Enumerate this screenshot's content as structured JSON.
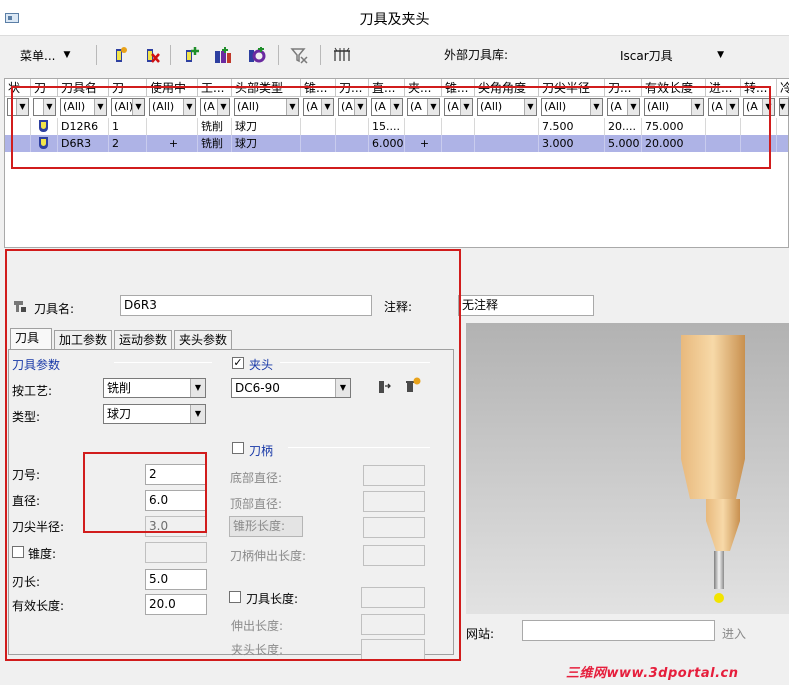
{
  "window": {
    "title": "刀具及夹头"
  },
  "toolbar": {
    "menu_label": "菜单...",
    "external_lib_label": "外部刀具库:",
    "external_lib_value": "Iscar刀具"
  },
  "grid": {
    "headers": [
      "状",
      "刀",
      "刀具名",
      "刀",
      "使用中",
      "工...",
      "头部类型",
      "锥...",
      "刀...",
      "直...",
      "夹...",
      "锥...",
      "尖角角度",
      "刀尖半径",
      "刀...",
      "有效长度",
      "进...",
      "转...",
      "冷"
    ],
    "filters": [
      "",
      "",
      "(All)",
      "(Al)",
      "(All)",
      "(A",
      "(All)",
      "(A",
      "(A",
      "(A",
      "(A",
      "(A",
      "(All)",
      "(All)",
      "(A",
      "(All)",
      "(A",
      "(A",
      "(A"
    ],
    "rows": [
      {
        "name": "D12R6",
        "num": "1",
        "in_use": "",
        "process": "铣削",
        "type": "球刀",
        "diameter": "15....",
        "holder": "",
        "corner_radius": "7.500",
        "col15": "20....",
        "eff_len": "75.000",
        "selected": false
      },
      {
        "name": "D6R3",
        "num": "2",
        "in_use": "+",
        "process": "铣削",
        "type": "球刀",
        "diameter": "6.000",
        "holder": "+",
        "corner_radius": "3.000",
        "col15": "5.000",
        "eff_len": "20.000",
        "selected": true
      }
    ]
  },
  "form": {
    "tool_name_label": "刀具名:",
    "tool_name_value": "D6R3",
    "comment_label": "注释:",
    "comment_value": "无注释",
    "tabs": [
      "刀具",
      "加工参数",
      "运动参数",
      "夹头参数"
    ],
    "tool_params_title": "刀具参数",
    "process_label": "按工艺:",
    "process_value": "铣削",
    "type_label": "类型:",
    "type_value": "球刀",
    "holder_chk_label": "夹头",
    "holder_value": "DC6-90",
    "shank_chk_label": "刀柄",
    "tool_no_label": "刀号:",
    "tool_no_value": "2",
    "diameter_label": "直径:",
    "diameter_value": "6.0",
    "corner_label": "刀尖半径:",
    "corner_value": "3.0",
    "taper_label": "锥度:",
    "flute_label": "刃长:",
    "flute_value": "5.0",
    "eff_len_label": "有效长度:",
    "eff_len_value": "20.0",
    "bottom_dia_label": "底部直径:",
    "top_dia_label": "顶部直径:",
    "taper_len_label": "锥形长度:",
    "shank_ext_label": "刀柄伸出长度:",
    "tool_len_chk_label": "刀具长度:",
    "ext_len_label": "伸出长度:",
    "holder_len_label": "夹头长度:"
  },
  "website": {
    "label": "网站:",
    "go_label": "进入"
  },
  "watermark": "三维网www.3dportal.cn"
}
